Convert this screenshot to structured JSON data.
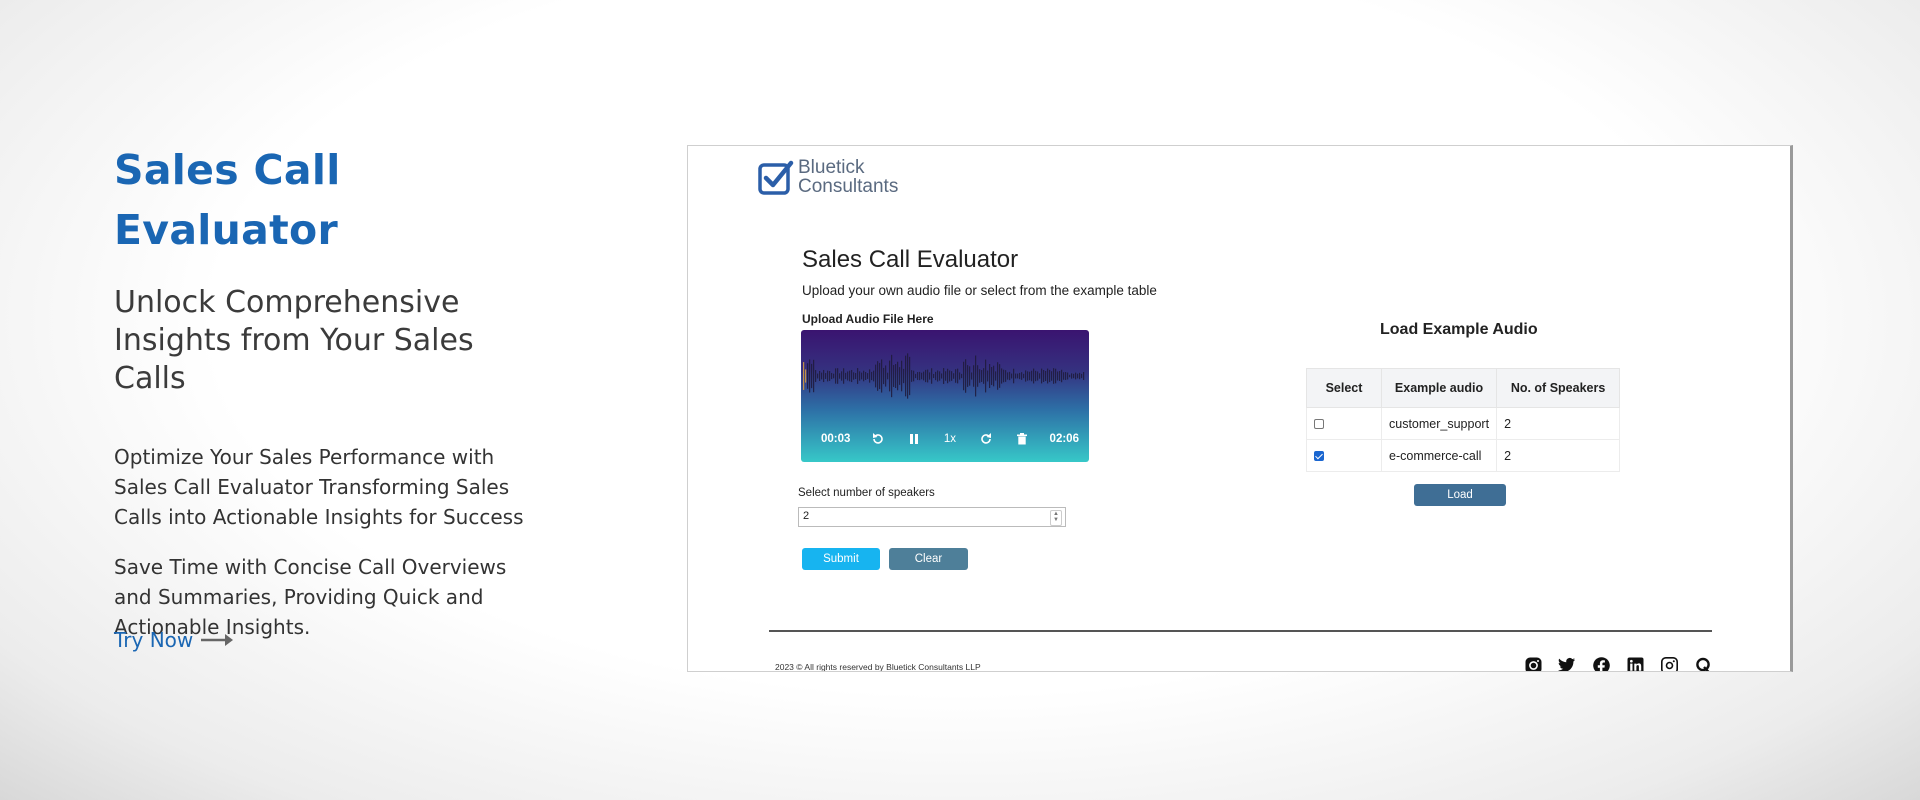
{
  "hero": {
    "title": "Sales Call Evaluator",
    "subtitle": "Unlock Comprehensive Insights from Your Sales Calls",
    "para1": "Optimize Your Sales Performance with Sales Call Evaluator Transforming Sales Calls into Actionable Insights for Success",
    "para2": "Save Time with Concise Call Overviews and Summaries, Providing Quick and Actionable Insights.",
    "cta": "Try Now",
    "cta_icon": "arrow-right-icon"
  },
  "app": {
    "logo_line1": "Bluetick",
    "logo_line2": "Consultants",
    "title": "Sales Call Evaluator",
    "subtitle": "Upload your own audio file or select from the example table",
    "upload_label": "Upload Audio File Here",
    "player": {
      "current_time": "00:03",
      "duration": "02:06",
      "speed": "1x",
      "icons": [
        "rewind-icon",
        "pause-icon",
        "forward-icon",
        "trash-icon"
      ]
    },
    "speakers_label": "Select number of speakers",
    "speakers_value": "2",
    "submit_label": "Submit",
    "clear_label": "Clear",
    "examples": {
      "title": "Load Example Audio",
      "headers": [
        "Select",
        "Example audio",
        "No. of Speakers"
      ],
      "rows": [
        {
          "selected": false,
          "name": "customer_support",
          "speakers": "2"
        },
        {
          "selected": true,
          "name": "e-commerce-call",
          "speakers": "2"
        }
      ],
      "load_label": "Load"
    },
    "footer": "2023 © All rights reserved by Bluetick Consultants LLP",
    "social_icons": [
      "instagram-icon",
      "twitter-icon",
      "facebook-icon",
      "linkedin-icon",
      "threads-icon",
      "quora-icon"
    ]
  },
  "colors": {
    "brand_blue": "#1a66b3",
    "submit": "#17b4f0",
    "clear": "#4e7f99",
    "load": "#3f6e95"
  }
}
